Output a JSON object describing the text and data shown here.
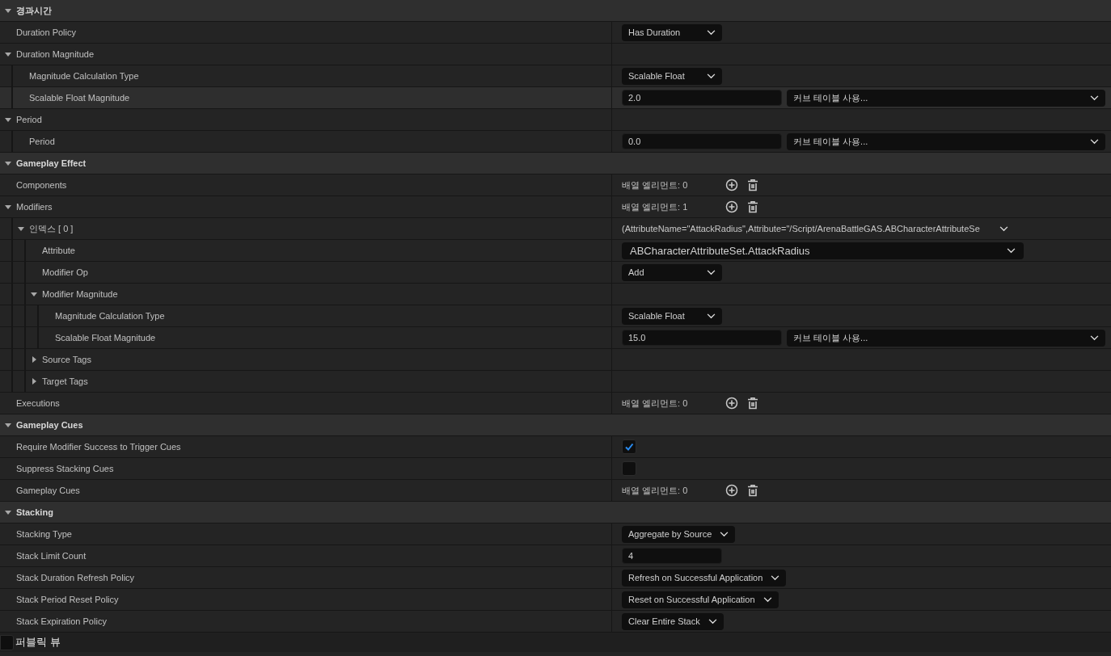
{
  "sections": [
    {
      "title": "경과시간",
      "expanded": true,
      "rows": [
        {
          "label": "Duration Policy",
          "hovered": false,
          "value": {
            "kind": "dropdown",
            "text": "Has Duration"
          }
        },
        {
          "label": "Duration Magnitude",
          "hovered": false,
          "expanded": true,
          "children": [
            {
              "label": "Magnitude Calculation Type",
              "hovered": false,
              "value": {
                "kind": "dropdown",
                "text": "Scalable Float"
              }
            },
            {
              "label": "Scalable Float Magnitude",
              "hovered": true,
              "value": {
                "kind": "float_curve",
                "number": "2.0",
                "curve": "커브 테이블 사용..."
              }
            }
          ]
        },
        {
          "label": "Period",
          "hovered": false,
          "expanded": true,
          "children": [
            {
              "label": "Period",
              "hovered": false,
              "value": {
                "kind": "float_curve",
                "number": "0.0",
                "curve": "커브 테이블 사용..."
              }
            }
          ]
        }
      ]
    },
    {
      "title": "Gameplay Effect",
      "expanded": true,
      "rows": [
        {
          "label": "Components",
          "hovered": false,
          "value": {
            "kind": "array",
            "text": "배열 엘리먼트: 0"
          }
        },
        {
          "label": "Modifiers",
          "hovered": false,
          "expanded": true,
          "value": {
            "kind": "array",
            "text": "배열 엘리먼트: 1"
          },
          "children": [
            {
              "label": "인덱스 [ 0 ]",
              "hovered": false,
              "expanded": true,
              "value": {
                "kind": "struct",
                "text": "(AttributeName=\"AttackRadius\",Attribute=\"/Script/ArenaBattleGAS.ABCharacterAttributeSe"
              },
              "children": [
                {
                  "label": "Attribute",
                  "hovered": false,
                  "value": {
                    "kind": "wide_dropdown",
                    "text": "ABCharacterAttributeSet.AttackRadius"
                  }
                },
                {
                  "label": "Modifier Op",
                  "hovered": false,
                  "value": {
                    "kind": "dropdown",
                    "text": "Add"
                  }
                },
                {
                  "label": "Modifier Magnitude",
                  "hovered": false,
                  "expanded": true,
                  "children": [
                    {
                      "label": "Magnitude Calculation Type",
                      "hovered": false,
                      "value": {
                        "kind": "dropdown",
                        "text": "Scalable Float"
                      }
                    },
                    {
                      "label": "Scalable Float Magnitude",
                      "hovered": false,
                      "value": {
                        "kind": "float_curve",
                        "number": "15.0",
                        "curve": "커브 테이블 사용..."
                      }
                    }
                  ]
                },
                {
                  "label": "Source Tags",
                  "hovered": false,
                  "expanded": false
                },
                {
                  "label": "Target Tags",
                  "hovered": false,
                  "expanded": false
                }
              ]
            }
          ]
        },
        {
          "label": "Executions",
          "hovered": false,
          "value": {
            "kind": "array",
            "text": "배열 엘리먼트: 0"
          }
        }
      ]
    },
    {
      "title": "Gameplay Cues",
      "expanded": true,
      "rows": [
        {
          "label": "Require Modifier Success to Trigger Cues",
          "hovered": false,
          "value": {
            "kind": "checkbox",
            "checked": true
          }
        },
        {
          "label": "Suppress Stacking Cues",
          "hovered": false,
          "value": {
            "kind": "checkbox",
            "checked": false
          }
        },
        {
          "label": "Gameplay Cues",
          "hovered": false,
          "value": {
            "kind": "array",
            "text": "배열 엘리먼트: 0"
          }
        }
      ]
    },
    {
      "title": "Stacking",
      "expanded": true,
      "rows": [
        {
          "label": "Stacking Type",
          "hovered": false,
          "value": {
            "kind": "dropdown",
            "text": "Aggregate by Source"
          }
        },
        {
          "label": "Stack Limit Count",
          "hovered": false,
          "value": {
            "kind": "number",
            "text": "4"
          }
        },
        {
          "label": "Stack Duration Refresh Policy",
          "hovered": false,
          "value": {
            "kind": "dropdown",
            "text": "Refresh on Successful Application"
          }
        },
        {
          "label": "Stack Period Reset Policy",
          "hovered": false,
          "value": {
            "kind": "dropdown",
            "text": "Reset on Successful Application"
          }
        },
        {
          "label": "Stack Expiration Policy",
          "hovered": false,
          "value": {
            "kind": "dropdown",
            "text": "Clear Entire Stack"
          }
        }
      ]
    }
  ],
  "footer": {
    "label": "퍼블릭 뷰",
    "checked": false
  }
}
